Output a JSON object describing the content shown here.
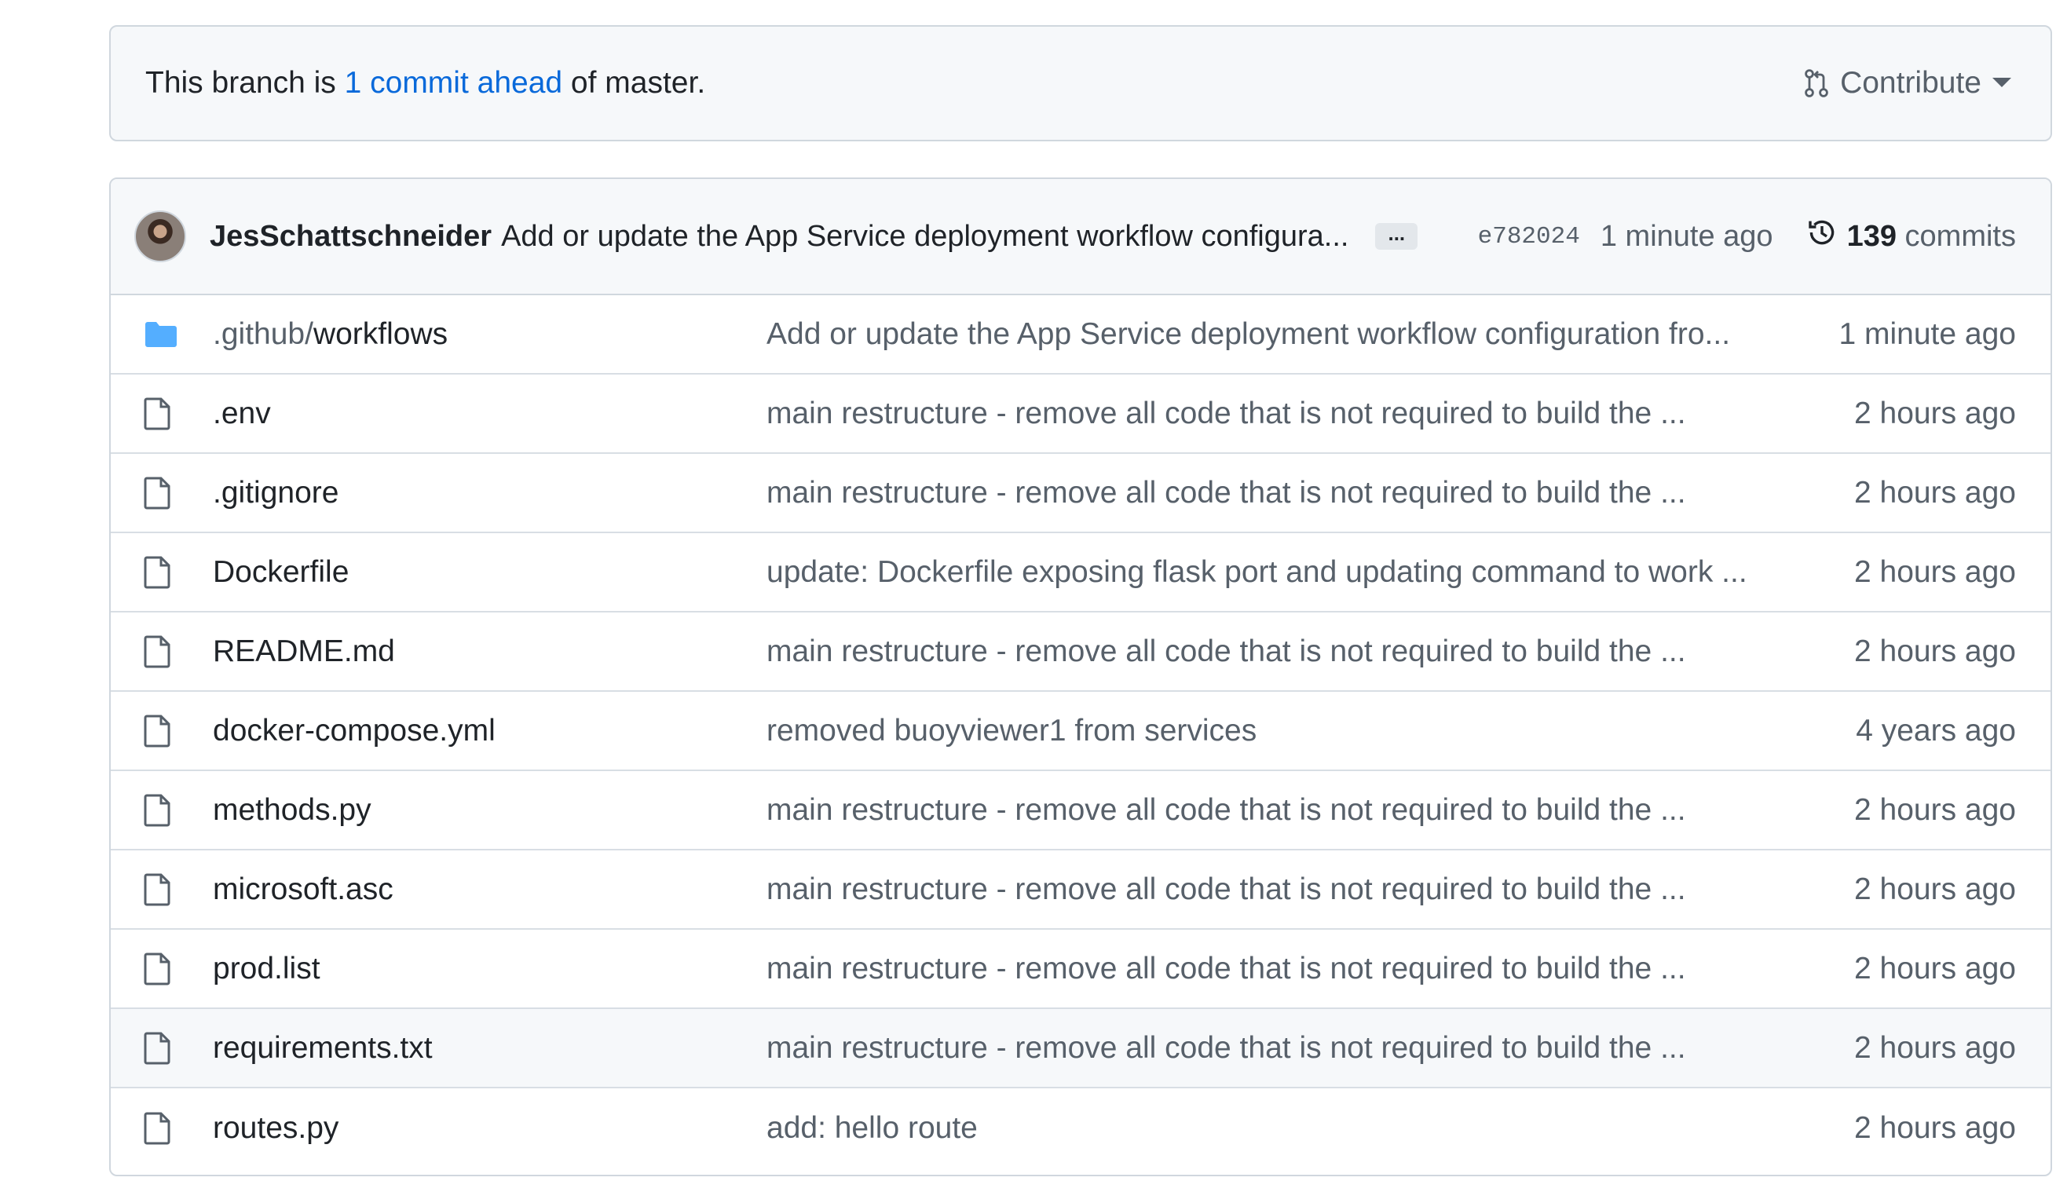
{
  "colors": {
    "link": "#0969da",
    "muted": "#57606a",
    "folder": "#54aeff",
    "border": "#d0d7de"
  },
  "banner": {
    "prefix": "This branch is ",
    "link": "1 commit ahead",
    "suffix": " of master.",
    "contribute_label": "Contribute"
  },
  "latest_commit": {
    "author": "JesSchattschneider",
    "message": "Add or update the App Service deployment workflow configura...",
    "ellipsis": "...",
    "sha": "e782024",
    "time": "1 minute ago",
    "commit_count": "139",
    "commits_label": "commits"
  },
  "files": [
    {
      "icon": "folder-icon",
      "name_dim": ".github/",
      "name": "workflows",
      "message": "Add or update the App Service deployment workflow configuration fro...",
      "age": "1 minute ago"
    },
    {
      "icon": "file-icon",
      "name_dim": "",
      "name": ".env",
      "message": "main restructure - remove all code that is not required to build the ...",
      "age": "2 hours ago"
    },
    {
      "icon": "file-icon",
      "name_dim": "",
      "name": ".gitignore",
      "message": "main restructure - remove all code that is not required to build the ...",
      "age": "2 hours ago"
    },
    {
      "icon": "file-icon",
      "name_dim": "",
      "name": "Dockerfile",
      "message": "update: Dockerfile exposing flask port and updating command to work ...",
      "age": "2 hours ago"
    },
    {
      "icon": "file-icon",
      "name_dim": "",
      "name": "README.md",
      "message": "main restructure - remove all code that is not required to build the ...",
      "age": "2 hours ago"
    },
    {
      "icon": "file-icon",
      "name_dim": "",
      "name": "docker-compose.yml",
      "message": "removed buoyviewer1 from services",
      "age": "4 years ago"
    },
    {
      "icon": "file-icon",
      "name_dim": "",
      "name": "methods.py",
      "message": "main restructure - remove all code that is not required to build the ...",
      "age": "2 hours ago"
    },
    {
      "icon": "file-icon",
      "name_dim": "",
      "name": "microsoft.asc",
      "message": "main restructure - remove all code that is not required to build the ...",
      "age": "2 hours ago"
    },
    {
      "icon": "file-icon",
      "name_dim": "",
      "name": "prod.list",
      "message": "main restructure - remove all code that is not required to build the ...",
      "age": "2 hours ago"
    },
    {
      "icon": "file-icon",
      "name_dim": "",
      "name": "requirements.txt",
      "message": "main restructure - remove all code that is not required to build the ...",
      "age": "2 hours ago"
    },
    {
      "icon": "file-icon",
      "name_dim": "",
      "name": "routes.py",
      "message": "add: hello route",
      "age": "2 hours ago"
    }
  ]
}
